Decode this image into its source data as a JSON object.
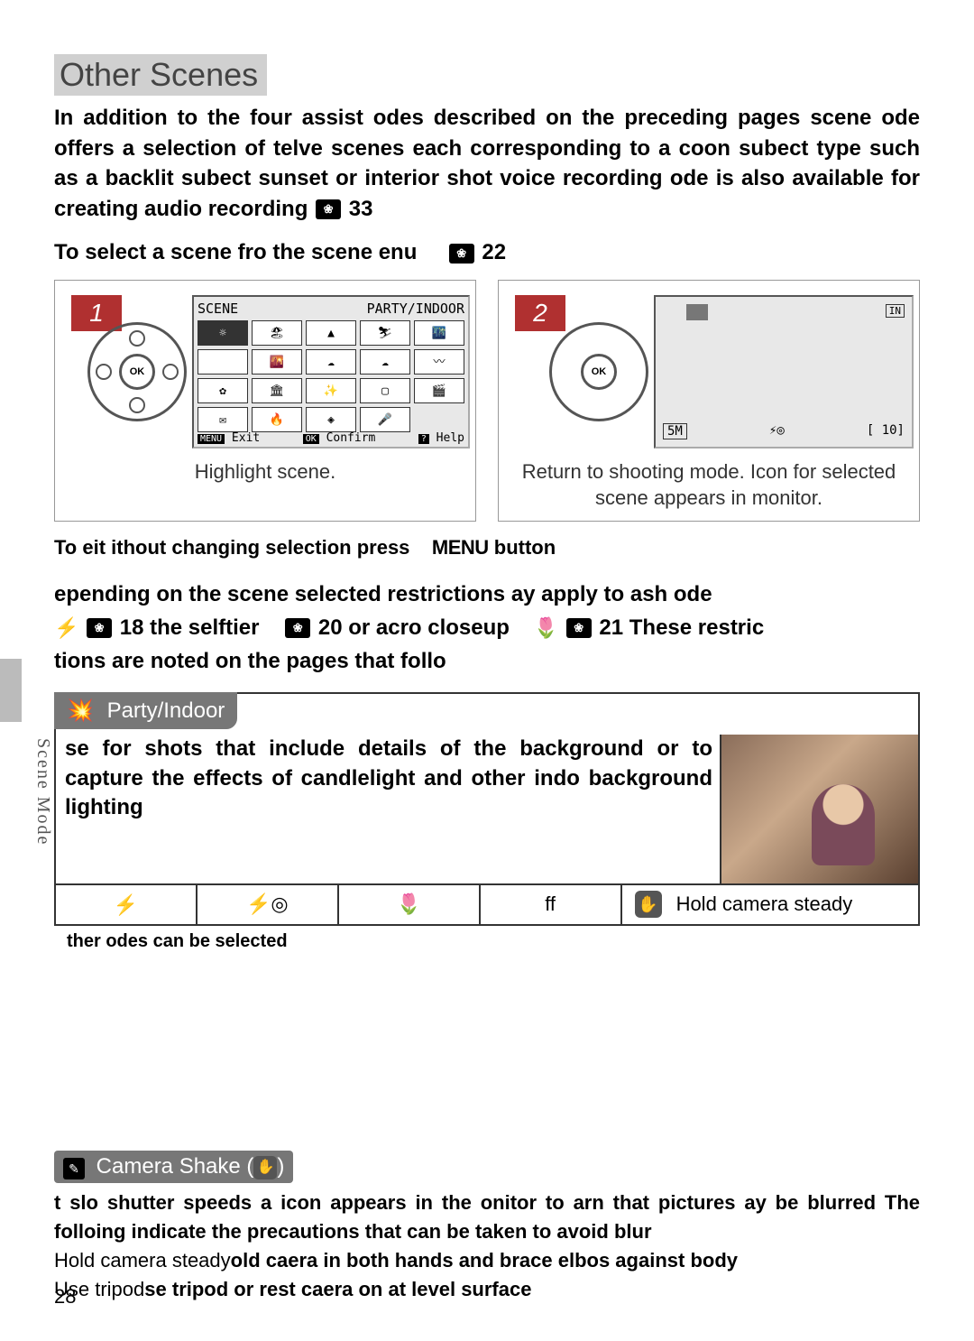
{
  "section_title": "Other Scenes",
  "intro": "In addition to the four assist odes described on the preceding pages scene ode offers a selection of telve scenes each corresponding to a coon subect type such as a backlit subect sunset or interior shot voice recording ode is also available for creating audio recording",
  "intro_ref": "33",
  "select_line": {
    "text": "To select a scene fro the scene enu",
    "ref": "22"
  },
  "step1": {
    "number": "1",
    "screen_header_left": "SCENE",
    "screen_header_right": "PARTY/INDOOR",
    "icons": [
      "💡",
      "🏖",
      "🖼",
      "⛷",
      "🌃",
      "🌇8",
      "🌅",
      "🌆",
      "🎆",
      "🐟",
      "🏛",
      "✨",
      "▢",
      "🎬",
      "✉",
      "🔥",
      "🔊",
      ""
    ],
    "footer_exit": "Exit",
    "footer_confirm": "Confirm",
    "footer_help": "Help",
    "caption": "Highlight scene."
  },
  "step2": {
    "number": "2",
    "badge_in": "IN",
    "bottom_left": "5M",
    "bottom_mid": "⚡◎",
    "bottom_right": "[  10]",
    "caption": "Return to shooting mode. Icon for selected scene appears in monitor."
  },
  "exit_line": {
    "pre": "To eit ithout changing selection press",
    "menu": "MENU",
    "post": "button"
  },
  "depending": {
    "l1_pre": "epending on the scene selected restrictions ay apply to  ash ode",
    "ref18": "18",
    "l2_self": "the selftier",
    "ref20": "20",
    "l2_macro": "or acro closeup",
    "ref21": "21",
    "l2_end": "These restric",
    "l3": "tions are noted on the pages that follo"
  },
  "side_label": "Scene Mode",
  "scene": {
    "tab_label": "Party/Indoor",
    "desc": "se for shots that include details of the background or to capture the effects of candlelight and other indo background lighting",
    "footer": {
      "c1": "⚡",
      "c2": "⚡◎",
      "c3": "🌷",
      "c4": "ff",
      "hold": "Hold camera steady"
    }
  },
  "foot_note": "ther odes can be selected",
  "shake": {
    "title": "Camera Shake (",
    "title_close": ")",
    "body": "t slo shutter speeds a    icon appears in the onitor to arn that pictures ay be blurred  The folloing indicate the precautions that can be taken to avoid blur",
    "row1_label": "Hold camera steady",
    "row1_text": "old caera in both hands and brace elbos against body",
    "row2_label": "Use tripod",
    "row2_text": "se tripod or rest caera on  at level surface"
  },
  "page_number": "28"
}
